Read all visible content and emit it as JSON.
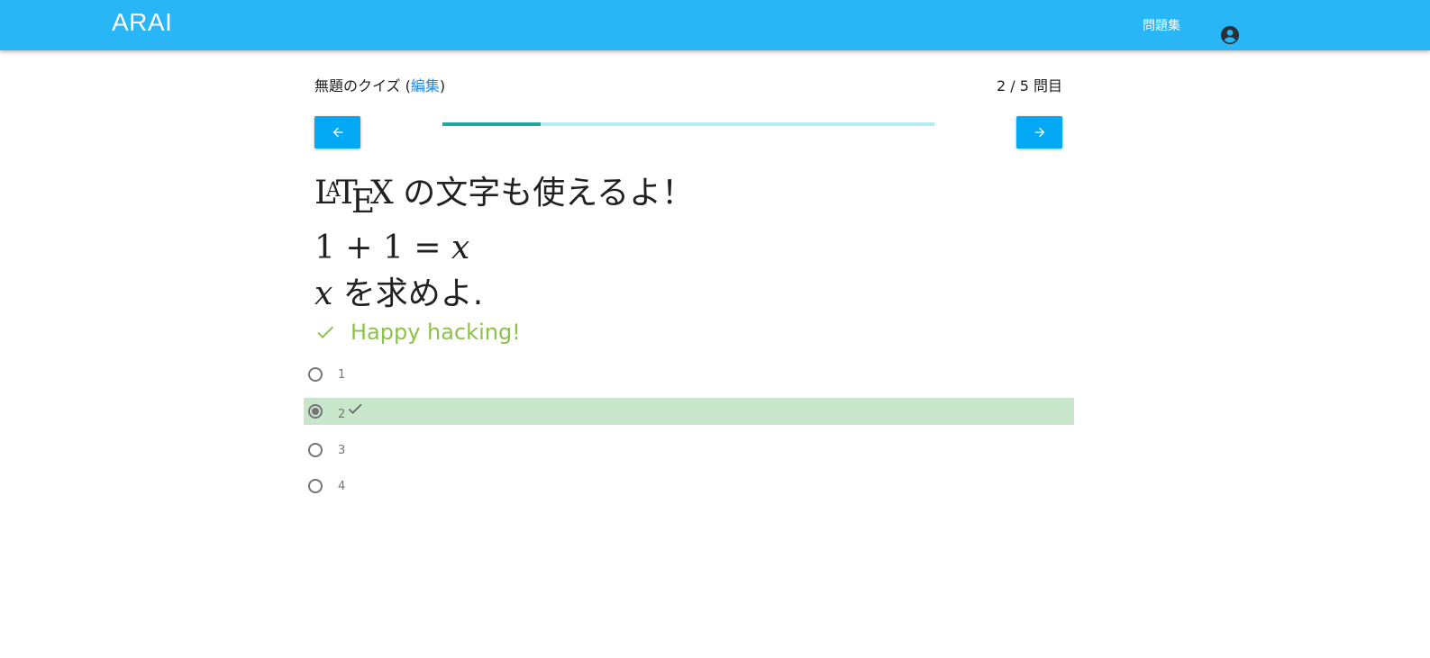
{
  "app": {
    "brand": "ARAI",
    "nav_link": "問題集",
    "account_icon": "account-circle-icon",
    "bar_color": "#29b6f6"
  },
  "quiz": {
    "title": "無題のクイズ",
    "edit_label": "編集",
    "counter": "2 / 5 問目",
    "progress_fraction": 0.2,
    "prev_icon": "arrow-left-icon",
    "next_icon": "arrow-right-icon"
  },
  "question": {
    "line1_logo": {
      "l": "L",
      "a": "A",
      "t": "T",
      "e": "E",
      "x": "X"
    },
    "line1_text": "の文字も使えるよ！",
    "line2_math": {
      "a": "1",
      "op1": "+",
      "b": "1",
      "op2": "=",
      "var": "x"
    },
    "line3_var": "x",
    "line3_text": "を求めよ."
  },
  "result": {
    "text": "Happy hacking!",
    "icon": "check-icon",
    "color": "#8bc34a"
  },
  "choices": [
    {
      "label": "1",
      "selected": false
    },
    {
      "label": "2",
      "selected": true,
      "correct": true
    },
    {
      "label": "3",
      "selected": false
    },
    {
      "label": "4",
      "selected": false
    }
  ]
}
